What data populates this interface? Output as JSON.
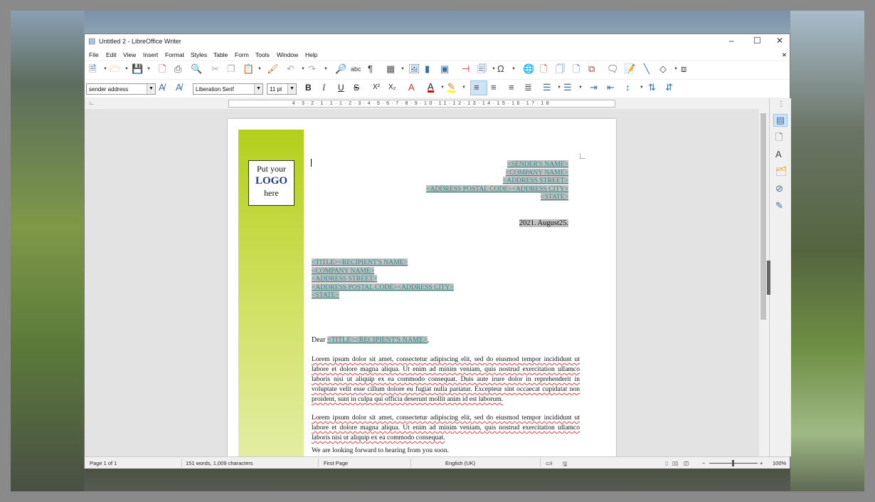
{
  "window": {
    "title": "Untitled 2 - LibreOffice Writer"
  },
  "menu": [
    "File",
    "Edit",
    "View",
    "Insert",
    "Format",
    "Styles",
    "Table",
    "Form",
    "Tools",
    "Window",
    "Help"
  ],
  "toolbar2": {
    "paragraph_style": "sender address",
    "font_name": "Liberation Serif",
    "font_size": "11 pt"
  },
  "ruler": {
    "ticks": "4·3·2·1·1·1·2·3·4·5·6·7·8·9·10·11·12·13·14·15·16·17·18"
  },
  "logo": {
    "line1": "Put your",
    "line2": "LOGO",
    "line3": "here"
  },
  "sender": [
    "<SENDER'S NAME>",
    "<COMPANY NAME>",
    "<ADDRESS STREET>",
    "<ADDRESS POSTAL CODE><ADDRESS CITY>",
    "<STATE>"
  ],
  "date": "2021. August25.",
  "recipient": [
    "<TITLE><RECIPIENT'S NAME>",
    "<COMPANY NAME>",
    "<ADDRESS STREET>",
    "<ADDRESS POSTAL CODE><ADDRESS CITY>",
    "<STATE>"
  ],
  "salutation": {
    "prefix": "Dear ",
    "field": "<TITLE><RECIPIENT'S NAME>",
    "suffix": ","
  },
  "paragraphs": [
    "Lorem ipsum dolor sit amet, consectetur adipiscing elit, sed do eiusmod tempor incididunt ut labore et dolore magna aliqua. Ut enim ad minim veniam, quis nostrud exercitation ullamco laboris nisi ut aliquip ex ea commodo consequat. Duis aute irure dolor in reprehenderit in voluptate velit esse cillum dolore eu fugiat nulla pariatur. Excepteur sint occaecat cupidatat non proident, sunt in culpa qui officia deserunt mollit anim id est laborum.",
    "Lorem ipsum dolor sit amet, consectetur adipiscing elit, sed do eiusmod tempor incididunt ut labore et dolore magna aliqua. Ut enim ad minim veniam, quis nostrud exercitation ullamco laboris nisi ut aliquip ex ea commodo consequat.",
    "We are looking forward to hearing from you soon."
  ],
  "status": {
    "page": "Page 1 of 1",
    "words": "151 words, 1,009 characters",
    "page_style": "First Page",
    "language": "English (UK)",
    "zoom": "100%"
  }
}
